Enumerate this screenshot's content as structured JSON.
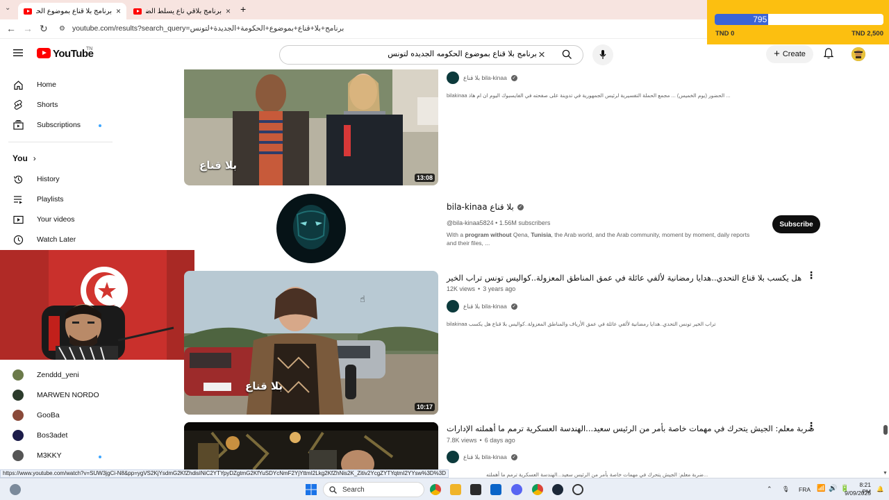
{
  "browser": {
    "tabs": [
      {
        "title": "برنامج بلا قناع بموضوع الحكومة ...",
        "active": true
      },
      {
        "title": "برنامج بلاقي ناع يسلط الضوء على...",
        "active": false
      }
    ],
    "new_tab": "+",
    "url": "youtube.com/results?search_query=برنامج+بلا+قناع+بموضوع+الحكومة+الجديدة+لتونس"
  },
  "donation": {
    "current": "795",
    "progress_percent": 31.8,
    "min_label": "TND 0",
    "max_label": "TND 2,500"
  },
  "youtube": {
    "logo_text": "YouTube",
    "logo_region": "TN",
    "search_value": "برنامج بلا قناع بموضوع الحكومه الجديده لتونس",
    "create_label": "Create"
  },
  "sidebar": {
    "items": [
      {
        "label": "Home",
        "icon": "home-icon"
      },
      {
        "label": "Shorts",
        "icon": "shorts-icon"
      },
      {
        "label": "Subscriptions",
        "icon": "subscriptions-icon"
      }
    ],
    "you_label": "You",
    "you_items": [
      {
        "label": "History",
        "icon": "history-icon"
      },
      {
        "label": "Playlists",
        "icon": "playlists-icon"
      },
      {
        "label": "Your videos",
        "icon": "your-videos-icon"
      },
      {
        "label": "Watch Later",
        "icon": "watch-later-icon"
      }
    ],
    "channels": [
      {
        "name": "Zenddd_yeni",
        "color": "#6b7a4a"
      },
      {
        "name": "MARWEN NORDO",
        "color": "#2c3b2c"
      },
      {
        "name": "GooBa",
        "color": "#8a4a3a"
      },
      {
        "name": "Bos3adet",
        "color": "#1c1c4a"
      },
      {
        "name": "M3KKY",
        "color": "#555555"
      }
    ]
  },
  "results": {
    "video1": {
      "duration": "13:08",
      "watermark": "بلا قناع",
      "channel": "بلا قناع bila-kinaa",
      "description": "bilakinaa الحضور (يوم الخميس) ... مجمع الحملة التفسيرية لرئيس الجمهورية في تدوينة على صفحته في الفايسبوك اليوم ان ام هاذ ..."
    },
    "channel_card": {
      "name": "bila-kinaa بلا قناع",
      "handle_subs": "@bila-kinaa5824 • 1.56M subscribers",
      "desc_pre": "With a ",
      "desc_b1": "program without",
      "desc_mid": " Qena, ",
      "desc_b2": "Tunisia",
      "desc_post": ", the Arab world, and the Arab community, moment by moment, daily reports",
      "desc_line2": "and their files, ...",
      "subscribe": "Subscribe"
    },
    "video2": {
      "title": "هل يكسب بلا قناع التحدي..هدايا رمضانية لألفي عائلة في عمق المناطق المعزولة..كواليس تونس تراب الخير",
      "views": "12K views",
      "age": "3 years ago",
      "duration": "10:17",
      "watermark": "بلا قناع",
      "channel": "بلا قناع bila-kinaa",
      "description": "bilakinaa تراب الخير تونس التحدي..هدايا رمضانية لألفي عائلة في عمق الأرياف والمناطق المعزولة..كواليس بلا قناع هل يكسب"
    },
    "video3": {
      "title": "ضربة معلم: الجيش يتحرك في مهمات خاصة بأمر من الرئيس سعيد...الهندسة العسكرية ترمم ما أهملته الإدارات",
      "views": "7.8K views",
      "age": "6 days ago",
      "channel": "بلا قناع bila-kinaa",
      "description": "ضربة معلم: الجيش يتحرك في مهمات خاصة بأمر من الرئيس سعيد...الهندسة العسكرية ترمم ما أهملته..."
    }
  },
  "status_url": "https://www.youtube.com/watch?v=SUW3jgCi-N8&pp=ygVS2KjYsdmG2KfZhdisINiC2YTYpyDZgtmG2KfYuSDYcNmF2YjYttmI2Lkg2KfZhNis2K_Zitiv2YcgZYTYqtmI2YYsw%3D%3D",
  "taskbar": {
    "search_label": "Search",
    "lang": "FRA",
    "time": "8:21 PM",
    "date": "9/09/2025"
  }
}
